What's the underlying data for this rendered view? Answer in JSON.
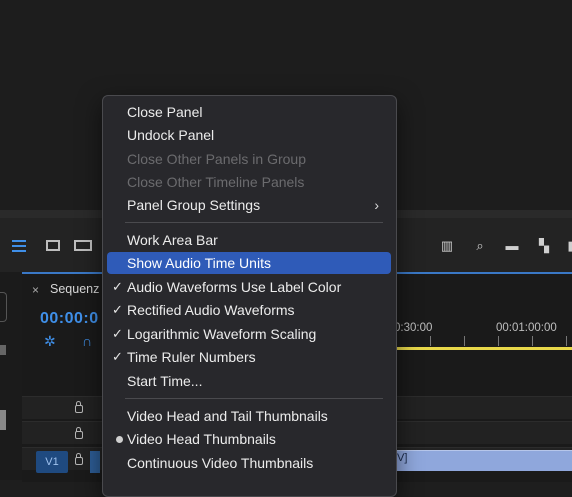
{
  "timeline": {
    "tab_close": "×",
    "tab_name": "Sequenz",
    "timecode": "00:00:0",
    "ruler_label_1": "0:30:00",
    "ruler_label_2": "00:01:00:00",
    "track_v1": "V1",
    "clip_label": "[V]"
  },
  "icons": {
    "toolbar_left": [
      "list-view-icon",
      "clip-icon",
      "stack-icon"
    ],
    "toolbar_right": [
      "library-icon",
      "search-icon",
      "folder-icon",
      "new-item-icon",
      "trash-icon"
    ]
  },
  "menu": {
    "items": [
      {
        "label": "Close Panel",
        "state": "normal"
      },
      {
        "label": "Undock Panel",
        "state": "normal"
      },
      {
        "label": "Close Other Panels in Group",
        "state": "disabled"
      },
      {
        "label": "Close Other Timeline Panels",
        "state": "disabled"
      },
      {
        "label": "Panel Group Settings",
        "state": "submenu",
        "arrow": "›"
      },
      {
        "label": "Work Area Bar",
        "state": "normal"
      },
      {
        "label": "Show Audio Time Units",
        "state": "selected"
      },
      {
        "label": "Audio Waveforms Use Label Color",
        "state": "checked",
        "check": "✓"
      },
      {
        "label": "Rectified Audio Waveforms",
        "state": "checked",
        "check": "✓"
      },
      {
        "label": "Logarithmic Waveform Scaling",
        "state": "checked",
        "check": "✓"
      },
      {
        "label": "Time Ruler Numbers",
        "state": "checked",
        "check": "✓"
      },
      {
        "label": "Start Time...",
        "state": "normal"
      },
      {
        "label": "Video Head and Tail Thumbnails",
        "state": "normal"
      },
      {
        "label": "Video Head Thumbnails",
        "state": "radio"
      },
      {
        "label": "Continuous Video Thumbnails",
        "state": "normal"
      }
    ]
  },
  "colors": {
    "accent": "#2f5bb8",
    "timecode": "#3f8fe8",
    "work_area": "#e8d84a",
    "clip": "#8fa7dc"
  }
}
